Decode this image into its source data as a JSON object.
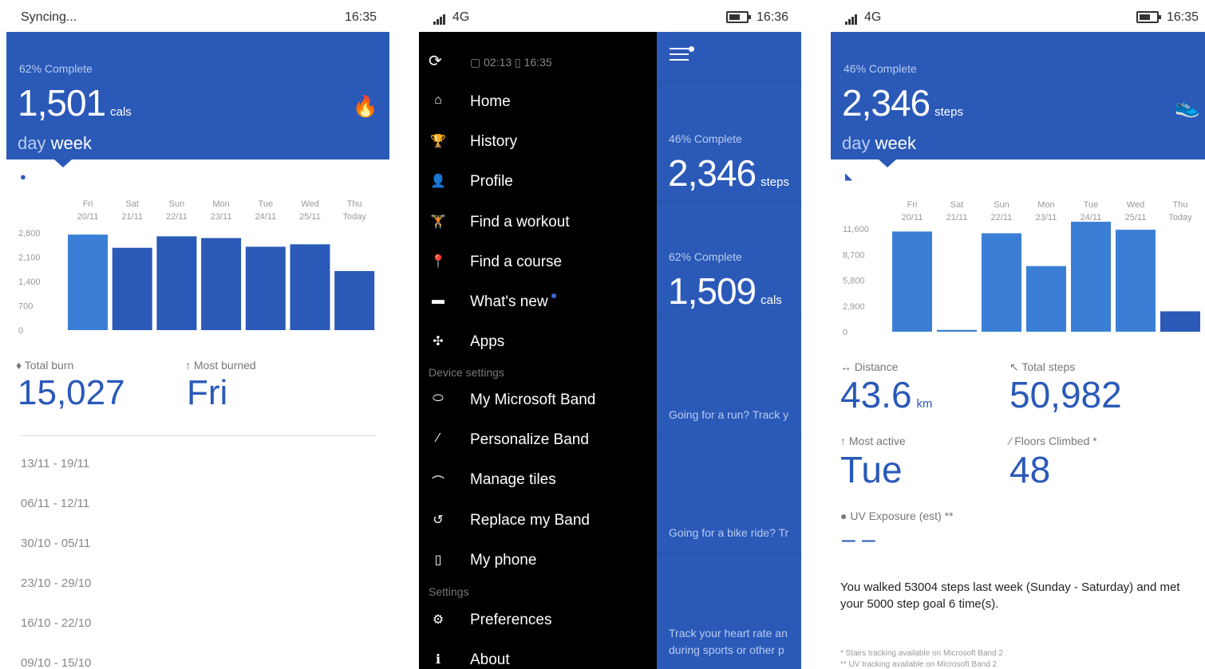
{
  "calories_screen": {
    "status": {
      "left": "Syncing...",
      "time": "16:35"
    },
    "header": {
      "percent": "62% Complete",
      "value": "1,501",
      "unit": "cals",
      "period_active": "day",
      "period_inactive": "week",
      "icon": "flame-icon"
    },
    "chart_data": {
      "type": "bar",
      "categories": [
        "Fri 20/11",
        "Sat 21/11",
        "Sun 22/11",
        "Mon 23/11",
        "Tue 24/11",
        "Wed 25/11",
        "Thu Today"
      ],
      "day_labels": [
        "Fri",
        "Sat",
        "Sun",
        "Mon",
        "Tue",
        "Wed",
        "Thu"
      ],
      "date_labels": [
        "20/11",
        "21/11",
        "22/11",
        "23/11",
        "24/11",
        "25/11",
        "Today"
      ],
      "values": [
        2750,
        2370,
        2700,
        2650,
        2400,
        2470,
        1700
      ],
      "y_ticks": [
        "2,800",
        "2,100",
        "1,400",
        "700",
        "0"
      ],
      "ylim": [
        0,
        2800
      ],
      "grid": false,
      "colors": [
        "#3a7fd5",
        "#2a59b8",
        "#2a59b8",
        "#2a59b8",
        "#2a59b8",
        "#2a59b8",
        "#2a59b8"
      ]
    },
    "stats": {
      "total_label": "Total burn",
      "total_value": "15,027",
      "most_label": "Most burned",
      "most_value": "Fri"
    },
    "weeks": [
      "13/11 - 19/11",
      "06/11 - 12/11",
      "30/10 - 05/11",
      "23/10 - 29/10",
      "16/10 - 22/10",
      "09/10 - 15/10"
    ]
  },
  "menu_screen": {
    "status": {
      "network": "4G",
      "time": "16:36"
    },
    "sync": {
      "band_time": "02:13",
      "phone_time": "16:35"
    },
    "items": [
      {
        "label": "Home",
        "icon": "home-icon",
        "glyph": "⌂"
      },
      {
        "label": "History",
        "icon": "trophy-icon",
        "glyph": "🏆"
      },
      {
        "label": "Profile",
        "icon": "person-icon",
        "glyph": "👤"
      },
      {
        "label": "Find a workout",
        "icon": "workout-icon",
        "glyph": "🏋"
      },
      {
        "label": "Find a course",
        "icon": "pin-icon",
        "glyph": "📍"
      },
      {
        "label": "What's new",
        "icon": "chat-icon",
        "glyph": "▬"
      },
      {
        "label": "Apps",
        "icon": "apps-icon",
        "glyph": "✣"
      }
    ],
    "device_section": "Device settings",
    "device_items": [
      {
        "label": "My Microsoft Band",
        "icon": "band-icon",
        "glyph": "⬭"
      },
      {
        "label": "Personalize Band",
        "icon": "brush-icon",
        "glyph": "⁄"
      },
      {
        "label": "Manage tiles",
        "icon": "tiles-icon",
        "glyph": "⌒"
      },
      {
        "label": "Replace my Band",
        "icon": "replace-icon",
        "glyph": "↺"
      },
      {
        "label": "My phone",
        "icon": "phone-icon",
        "glyph": "▯"
      }
    ],
    "settings_section": "Settings",
    "settings_items": [
      {
        "label": "Preferences",
        "icon": "gear-icon",
        "glyph": "⚙"
      },
      {
        "label": "About",
        "icon": "info-icon",
        "glyph": "ℹ"
      }
    ],
    "peek": {
      "tile1_percent": "46% Complete",
      "tile1_value": "2,346",
      "tile1_unit": "steps",
      "tile2_percent": "62% Complete",
      "tile2_value": "1,509",
      "tile2_unit": "cals",
      "tease1": "Going for a run? Track y",
      "tease2": "Going for a bike ride? Tr",
      "tease3a": "Track your heart rate an",
      "tease3b": "during sports or other p"
    }
  },
  "steps_screen": {
    "status": {
      "network": "4G",
      "time": "16:35"
    },
    "header": {
      "percent": "46% Complete",
      "value": "2,346",
      "unit": "steps",
      "period_active": "day",
      "period_inactive": "week",
      "icon": "shoe-icon"
    },
    "chart_data": {
      "type": "bar",
      "categories": [
        "Fri 20/11",
        "Sat 21/11",
        "Sun 22/11",
        "Mon 23/11",
        "Tue 24/11",
        "Wed 25/11",
        "Thu Today"
      ],
      "day_labels": [
        "Fri",
        "Sat",
        "Sun",
        "Mon",
        "Tue",
        "Wed",
        "Thu"
      ],
      "date_labels": [
        "20/11",
        "21/11",
        "22/11",
        "23/11",
        "24/11",
        "25/11",
        "Today"
      ],
      "values": [
        11300,
        200,
        11100,
        7400,
        12400,
        11500,
        2300
      ],
      "y_ticks": [
        "11,600",
        "8,700",
        "5,800",
        "2,900",
        "0"
      ],
      "ylim": [
        0,
        11600
      ],
      "grid": false,
      "colors": [
        "#3a7fd5",
        "#3a7fd5",
        "#3a7fd5",
        "#3a7fd5",
        "#3a7fd5",
        "#3a7fd5",
        "#2a59b8"
      ]
    },
    "stats": {
      "distance_label": "Distance",
      "distance_value": "43.6",
      "distance_unit": "km",
      "steps_label": "Total steps",
      "steps_value": "50,982",
      "active_label": "Most active",
      "active_value": "Tue",
      "floors_label": "Floors Climbed *",
      "floors_value": "48",
      "uv_label": "UV Exposure (est) **",
      "uv_value": "– –"
    },
    "summary": "You walked 53004 steps last week (Sunday - Saturday) and met your 5000 step goal 6 time(s).",
    "footnote1": "* Stairs tracking available on Microsoft Band 2",
    "footnote2": "** UV tracking available on Microsoft Band 2"
  }
}
